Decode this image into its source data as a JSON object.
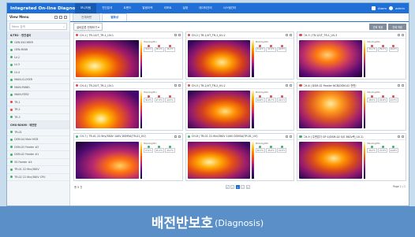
{
  "app": {
    "title": "Integrated On-line Diagnostic"
  },
  "menu": [
    "모니터링",
    "진단분석",
    "트렌드",
    "알람이력",
    "리포트",
    "설정",
    "데이터관리",
    "시스템관리"
  ],
  "user": {
    "alarm_label": "Alarm",
    "name": "admin"
  },
  "sidebar": {
    "title": "View Menu",
    "search_placeholder": "Menu 검색",
    "items": [
      {
        "label": "8/TR2 · 변전설비",
        "group": true
      },
      {
        "label": "GEN INCOMER",
        "status": "g"
      },
      {
        "label": "GEN-MAIN",
        "status": "g"
      },
      {
        "label": "LV-2",
        "status": "g"
      },
      {
        "label": "LV-3",
        "status": "g"
      },
      {
        "label": "LV-4",
        "status": "g"
      },
      {
        "label": "MAIN-CLOSER",
        "status": "g"
      },
      {
        "label": "MAIN-PANEL",
        "status": "g"
      },
      {
        "label": "MAIN-FEED",
        "status": "g"
      },
      {
        "label": "TR-1",
        "status": "r"
      },
      {
        "label": "TR-2",
        "status": "r"
      },
      {
        "label": "TR-3",
        "status": "g"
      },
      {
        "label": "CMS-ROOM · 배전반",
        "group": true
      },
      {
        "label": "TR-01",
        "status": "g"
      },
      {
        "label": "DSM-04 Main MCB",
        "status": "g"
      },
      {
        "label": "DSM-03 Feeder #2",
        "status": "g"
      },
      {
        "label": "DSM-02 Feeder #1",
        "status": "g"
      },
      {
        "label": "SS Feeder #4",
        "status": "g"
      },
      {
        "label": "TR-01 22.9kv/380V",
        "status": "g"
      },
      {
        "label": "TR-02 22.9kv/380V CPU",
        "status": "g"
      }
    ]
  },
  "tabs": [
    "전체화면",
    "열화상"
  ],
  "toolbar": {
    "select_value": "설비분류 전체보기 ▾",
    "buttons": [
      "선택 적용",
      "전체 적용"
    ]
  },
  "cards": [
    {
      "title": "CH-1 | TR-1/UT_TR-1_UV-1",
      "status": "r",
      "stats": [
        "32.4°C",
        "28.1°C",
        "25.3°C"
      ]
    },
    {
      "title": "CH-2 | TR-1/UT_TR-1_UV-2",
      "status": "r",
      "stats": [
        "31.6°C",
        "27.9°C",
        "24.8°C"
      ]
    },
    {
      "title": "CH-3 | TR-1/UT_TR-1_UV-3",
      "status": "r",
      "stats": [
        "33.1°C",
        "29.2°C",
        "26.0°C"
      ]
    },
    {
      "title": "CH-4 | TR-2/UT_TR-2_UV-1",
      "status": "r",
      "stats": [
        "30.9°C",
        "27.3°C",
        "24.5°C"
      ]
    },
    {
      "title": "CH-5 | TR-2/UT_TR-2_UV-2",
      "status": "r",
      "stats": [
        "29.8°C",
        "26.7°C",
        "24.1°C"
      ]
    },
    {
      "title": "CH-6 | DSM-02 Feeder NCB(DSM-02 전면)",
      "status": "r",
      "stats": [
        "28.5°C",
        "25.9°C",
        "23.7°C"
      ]
    },
    {
      "title": "CH-7 | TR-01 22.9kv/380V 100V DSM5A(TR-01_UV)",
      "status": "g",
      "stats": [
        "27.4°C",
        "25.1°C",
        "23.2°C"
      ]
    },
    {
      "title": "CH-8 | TR-01 22.9kv/380V 100V DSM5A(TR-01_UV)",
      "status": "g",
      "stats": [
        "28.1°C",
        "25.6°C",
        "23.5°C"
      ]
    },
    {
      "title": "CH-9 | 주변압기 GP 4(DSM-02 S/S 380V측_UV-1)",
      "status": "g",
      "stats": [
        "30.2°C",
        "27.0°C",
        "24.6°C"
      ]
    }
  ],
  "info_label": "Max/Avg/Min",
  "footer": {
    "count": "총 9 건",
    "pages": [
      "«",
      "‹",
      "1",
      "›",
      "»"
    ],
    "current_page": "1",
    "page_info": "Page 1 / 1"
  },
  "banner": {
    "title_ko": "배전반보호",
    "title_en": "(Diagnosis)"
  },
  "colors": {
    "accent": "#1f6fd6",
    "banner": "#5b8fc8",
    "alarm": "#e04848",
    "normal": "#3ab06a"
  }
}
